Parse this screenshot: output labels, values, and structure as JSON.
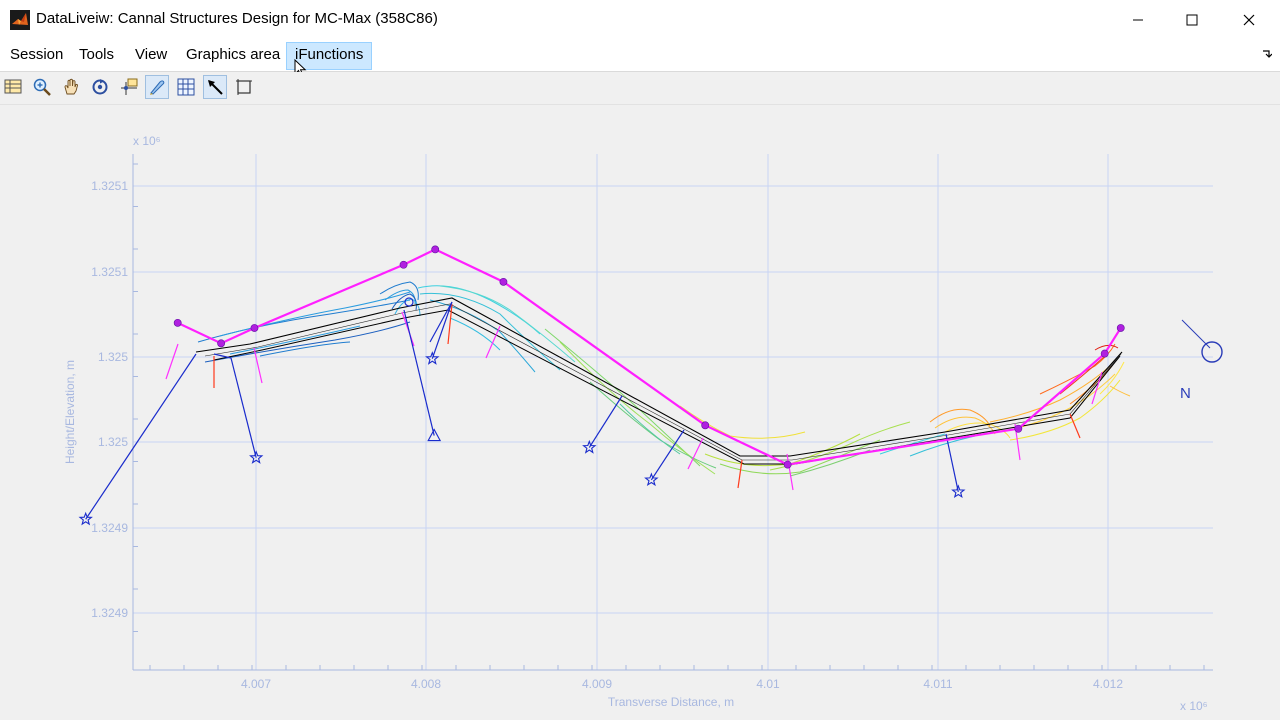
{
  "window": {
    "title": "DataLiveiw: Cannal Structures Design for MC-Max (358C86)",
    "controls": [
      "minimize-icon",
      "maximize-icon",
      "close-icon"
    ]
  },
  "menu": {
    "items": [
      {
        "label": "Session"
      },
      {
        "label": "Tools"
      },
      {
        "label": "View"
      },
      {
        "label": "Graphics area"
      },
      {
        "label": "iFunctions"
      }
    ],
    "active": "iFunctions"
  },
  "toolbar": {
    "tools": [
      "table-icon",
      "zoom-in-icon",
      "pan-hand-icon",
      "rotate-icon",
      "data-cursor-icon",
      "brush-icon",
      "grid-icon",
      "arrow-select-icon",
      "frame-icon"
    ],
    "toggled": [
      "brush-icon",
      "arrow-select-icon"
    ]
  },
  "chart_data": {
    "type": "line",
    "x_multiplier": "x 10⁶",
    "y_multiplier": "x 10⁶",
    "xlabel": "Transverse Distance, m",
    "ylabel": "Height/Elevation, m",
    "x_ticks": [
      "4.007",
      "4.008",
      "4.009",
      "4.01",
      "4.011",
      "4.012"
    ],
    "y_ticks": [
      "1.3251",
      "1.3251",
      "1.325",
      "1.325",
      "1.3249",
      "1.3249"
    ],
    "grid": true,
    "north_label": "N",
    "colors": {
      "centerline": "#ff20ff",
      "bank": "#000000",
      "vertex": "#b020e0",
      "leader": "#1a2ccc",
      "grid": "#c8d4f4"
    },
    "centerline_vertices": [
      [
        4.006542,
        1.32502
      ],
      [
        4.006796,
        1.325008
      ],
      [
        4.006991,
        1.325017
      ],
      [
        4.007863,
        1.325054
      ],
      [
        4.008048,
        1.325063
      ],
      [
        4.008447,
        1.325044
      ],
      [
        4.009627,
        1.32496
      ],
      [
        4.010109,
        1.324937
      ],
      [
        4.011458,
        1.324958
      ],
      [
        4.011963,
        1.325002
      ],
      [
        4.012057,
        1.325017
      ]
    ],
    "survey_markers": [
      {
        "type": "star",
        "x": 4.006004,
        "y": 1.324905
      },
      {
        "type": "star",
        "x": 4.007001,
        "y": 1.324941
      },
      {
        "type": "star",
        "x": 4.008031,
        "y": 1.324999
      },
      {
        "type": "triangle",
        "x": 4.008042,
        "y": 1.324954
      },
      {
        "type": "star",
        "x": 4.008949,
        "y": 1.324947
      },
      {
        "type": "star",
        "x": 4.009312,
        "y": 1.324928
      },
      {
        "type": "star",
        "x": 4.011107,
        "y": 1.324921
      }
    ]
  }
}
